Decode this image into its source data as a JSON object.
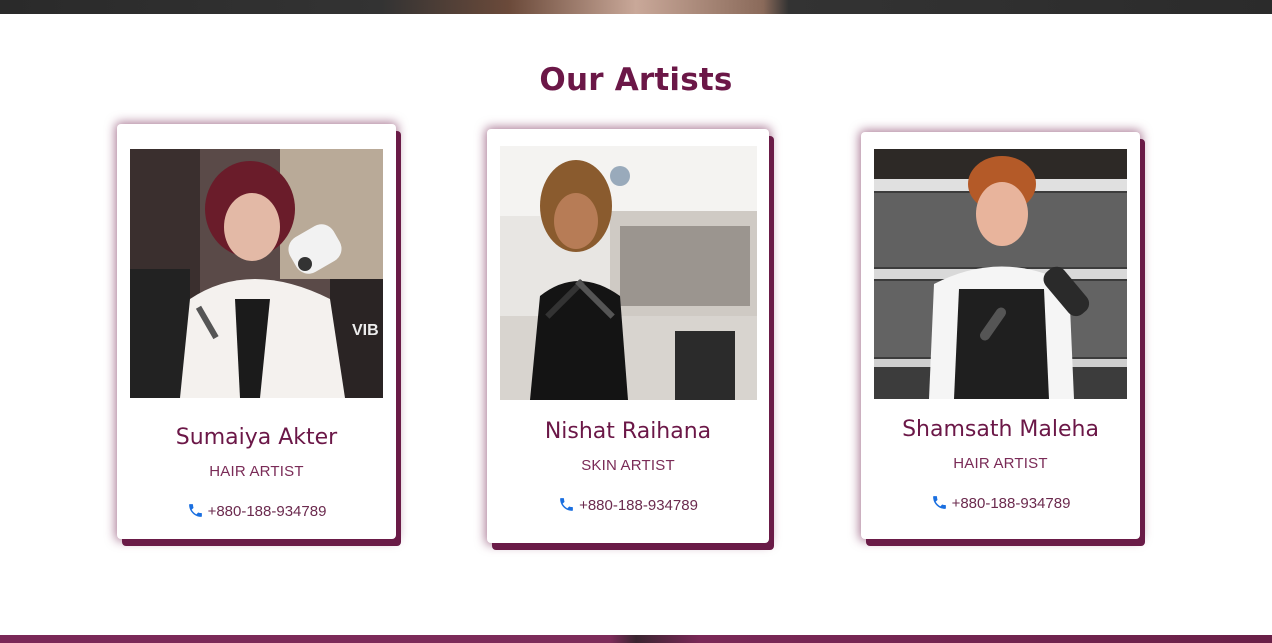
{
  "section": {
    "title": "Our Artists"
  },
  "artists": [
    {
      "name": "Sumaiya Akter",
      "role": "HAIR ARTIST",
      "phone": "+880-188-934789",
      "photo_text": "VIB"
    },
    {
      "name": "Nishat Raihana",
      "role": "SKIN ARTIST",
      "phone": "+880-188-934789"
    },
    {
      "name": "Shamsath Maleha",
      "role": "HAIR ARTIST",
      "phone": "+880-188-934789"
    }
  ],
  "colors": {
    "accent": "#6b1747",
    "phone_icon": "#1a6fe0"
  },
  "icons": {
    "phone": "phone-icon"
  }
}
